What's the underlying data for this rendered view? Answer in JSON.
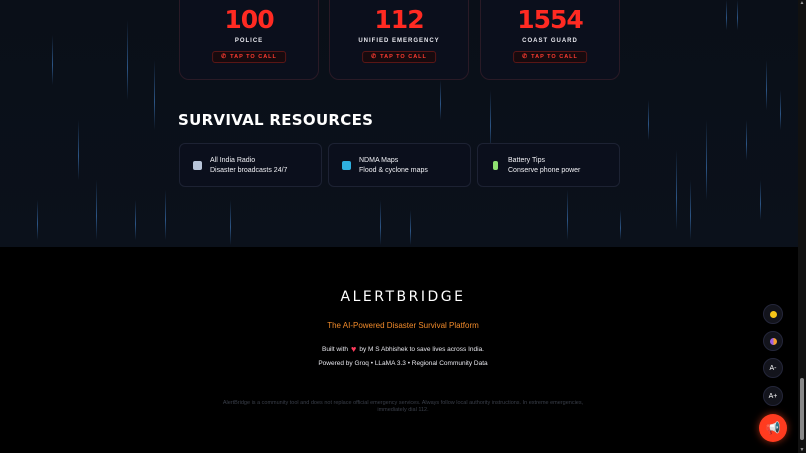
{
  "emergency_cards": [
    {
      "number": "100",
      "label": "POLICE",
      "call": "TAP TO CALL"
    },
    {
      "number": "112",
      "label": "UNIFIED EMERGENCY",
      "call": "TAP TO CALL"
    },
    {
      "number": "1554",
      "label": "COAST GUARD",
      "call": "TAP TO CALL"
    }
  ],
  "resources": {
    "title": "SURVIVAL RESOURCES",
    "items": [
      {
        "name": "All India Radio",
        "desc": "Disaster broadcasts 24/7",
        "icon": "radio-icon",
        "icon_color": "#b8c4d8"
      },
      {
        "name": "NDMA Maps",
        "desc": "Flood & cyclone maps",
        "icon": "map-icon",
        "icon_color": "#2fb0e0"
      },
      {
        "name": "Battery Tips",
        "desc": "Conserve phone power",
        "icon": "battery-icon",
        "icon_color": "#8ee070"
      }
    ]
  },
  "footer": {
    "brand": "ALERTBRIDGE",
    "tagline": "The AI-Powered Disaster Survival Platform",
    "built_prefix": "Built with",
    "built_suffix": "by M S Abhishek to save lives across India.",
    "powered": "Powered by Groq • LLaMA 3.3 • Regional Community Data",
    "disclaimer": "AlertBridge is a community tool and does not replace official emergency services. Always follow local authority instructions. In extreme emergencies, immediately dial 112."
  },
  "floating": {
    "theme_dot_color": "#f5c518",
    "contrast_dot_color": "#a060e0",
    "font_decrease": "A-",
    "font_increase": "A+",
    "sos_icon": "megaphone-icon"
  },
  "colors": {
    "accent_red": "#ff2a22",
    "accent_orange": "#f08a2a",
    "sos": "#ff3b1f"
  }
}
